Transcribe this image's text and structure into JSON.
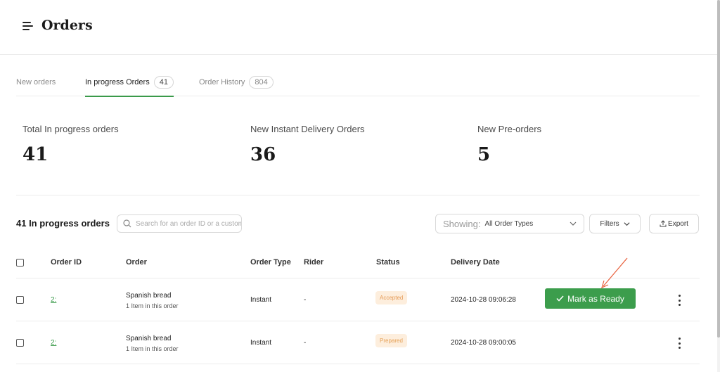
{
  "header": {
    "title": "Orders"
  },
  "tabs": [
    {
      "label": "New orders",
      "count": null,
      "active": false
    },
    {
      "label": "In progress Orders",
      "count": "41",
      "active": true
    },
    {
      "label": "Order History",
      "count": "804",
      "active": false
    }
  ],
  "stats": [
    {
      "label": "Total In progress orders",
      "value": "41"
    },
    {
      "label": "New Instant Delivery Orders",
      "value": "36"
    },
    {
      "label": "New Pre-orders",
      "value": "5"
    }
  ],
  "toolbar": {
    "list_title": "41 In progress orders",
    "search_placeholder": "Search for an order ID or a customer",
    "showing_label": "Showing:",
    "showing_value": "All Order Types",
    "filters_label": "Filters",
    "export_label": "Export"
  },
  "table": {
    "headers": {
      "order_id": "Order ID",
      "order": "Order",
      "order_type": "Order Type",
      "rider": "Rider",
      "status": "Status",
      "delivery_date": "Delivery Date"
    },
    "rows": [
      {
        "order_id": "2:",
        "item": "Spanish bread",
        "item_sub": "1 Item in this order",
        "order_type": "Instant",
        "rider": "-",
        "status": "Accepted",
        "delivery_date": "2024-10-28 09:06:28",
        "action_label": "Mark as Ready"
      },
      {
        "order_id": "2:",
        "item": "Spanish bread",
        "item_sub": "1 Item in this order",
        "order_type": "Instant",
        "rider": "-",
        "status": "Prepared",
        "delivery_date": "2024-10-28 09:00:05"
      }
    ]
  },
  "colors": {
    "accent_green": "#3c9d4c",
    "badge_bg": "#fdeedd",
    "badge_text": "#e59a55",
    "annotation_arrow": "#e8603c"
  },
  "icons": [
    "menu-icon",
    "search-icon",
    "chevron-down-icon",
    "export-icon",
    "check-icon",
    "more-vertical-icon"
  ]
}
